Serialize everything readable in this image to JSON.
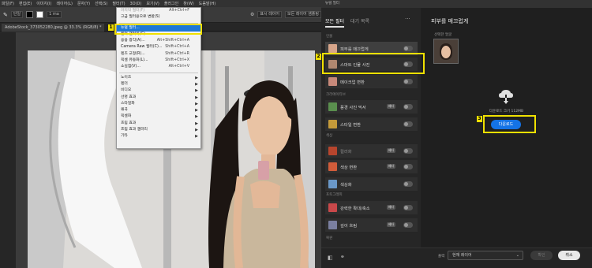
{
  "menubar": [
    "파일(F)",
    "편집(E)",
    "이미지(I)",
    "레이어(L)",
    "문자(Y)",
    "선택(S)",
    "필터(T)",
    "3D(D)",
    "보기(V)",
    "플러그인",
    "창(W)",
    "도움말(H)"
  ],
  "options": {
    "sample": "단일",
    "size": "1 ma",
    "layer_label": "표시 레이어",
    "sample_all": "모든 레이어 샘플링"
  },
  "document_tab": "AdobeStock_373052280.jpeg @ 33.3% (RGB/8) *",
  "filter_menu": {
    "items": [
      {
        "label": "마지막 필터(F)",
        "shortcut": "Alt+Ctrl+F",
        "disabled": true
      },
      {
        "label": "고급 필터용으로 변환(S)",
        "shortcut": ""
      },
      {
        "sep": true
      },
      {
        "label": "뉴럴 필터...",
        "shortcut": "",
        "highlight": true
      },
      {
        "label": "필터 갤러리(G)...",
        "shortcut": ""
      },
      {
        "label": "응용 광각(A)...",
        "shortcut": "Alt+Shift+Ctrl+A"
      },
      {
        "label": "Camera Raw 필터(C)...",
        "shortcut": "Shift+Ctrl+A"
      },
      {
        "label": "렌즈 교정(R)...",
        "shortcut": "Shift+Ctrl+R"
      },
      {
        "label": "픽셀 유동화(L)...",
        "shortcut": "Shift+Ctrl+X"
      },
      {
        "label": "소실점(V)...",
        "shortcut": "Alt+Ctrl+V"
      },
      {
        "sep": true
      },
      {
        "label": "노이즈",
        "submenu": true
      },
      {
        "label": "렌더",
        "submenu": true
      },
      {
        "label": "비디오",
        "submenu": true
      },
      {
        "label": "선명 효과",
        "submenu": true
      },
      {
        "label": "스타일화",
        "submenu": true
      },
      {
        "label": "왜곡",
        "submenu": true
      },
      {
        "label": "픽셀화",
        "submenu": true
      },
      {
        "label": "흐림 효과",
        "submenu": true
      },
      {
        "label": "흐림 효과 갤러리",
        "submenu": true
      },
      {
        "label": "기타",
        "submenu": true
      }
    ]
  },
  "callouts": [
    "1",
    "2",
    "3"
  ],
  "neural_filters": {
    "window_title": "뉴럴 필터",
    "tabs": [
      "모든 필터",
      "대기 목록"
    ],
    "more_icon": "more-dots-icon",
    "categories": [
      {
        "name": "인물",
        "filters": [
          {
            "name": "피부를 매끄럽게",
            "selected": true,
            "thumb": "#d7a58a"
          },
          {
            "name": "스마트 인물 사진",
            "thumb": "#b08870"
          },
          {
            "name": "메이크업 변환",
            "thumb": "#c7897a"
          }
        ]
      },
      {
        "name": "크리에이티브",
        "filters": [
          {
            "name": "풍경 사진 믹서",
            "beta": "베타",
            "thumb": "#5a8f4e"
          },
          {
            "name": "스타일 변환",
            "thumb": "#c49a3a"
          }
        ]
      },
      {
        "name": "색상",
        "filters": [
          {
            "name": "컬러화",
            "beta": "베타",
            "thumb": "#b7452d",
            "dim": true
          },
          {
            "name": "색상 변환",
            "beta": "베타",
            "thumb": "#d05c3a"
          },
          {
            "name": "색상화",
            "thumb": "#6a98c8"
          }
        ]
      },
      {
        "name": "포토그래피",
        "filters": [
          {
            "name": "강력한 확대/축소",
            "beta": "베타",
            "thumb": "#c9484a"
          },
          {
            "name": "깊이 흐림",
            "beta": "베타",
            "thumb": "#7a7fa0"
          }
        ]
      },
      {
        "name": "복원",
        "filters": []
      }
    ],
    "right": {
      "title": "피부를 매끄럽게",
      "selected_face": "선택한 얼굴",
      "download_size": "다운로드 크기 112MB",
      "download_button": "다운로드"
    },
    "output_label": "출력",
    "output_value": "현재 레이어",
    "ok_button": "확인",
    "cancel_button": "취소"
  }
}
